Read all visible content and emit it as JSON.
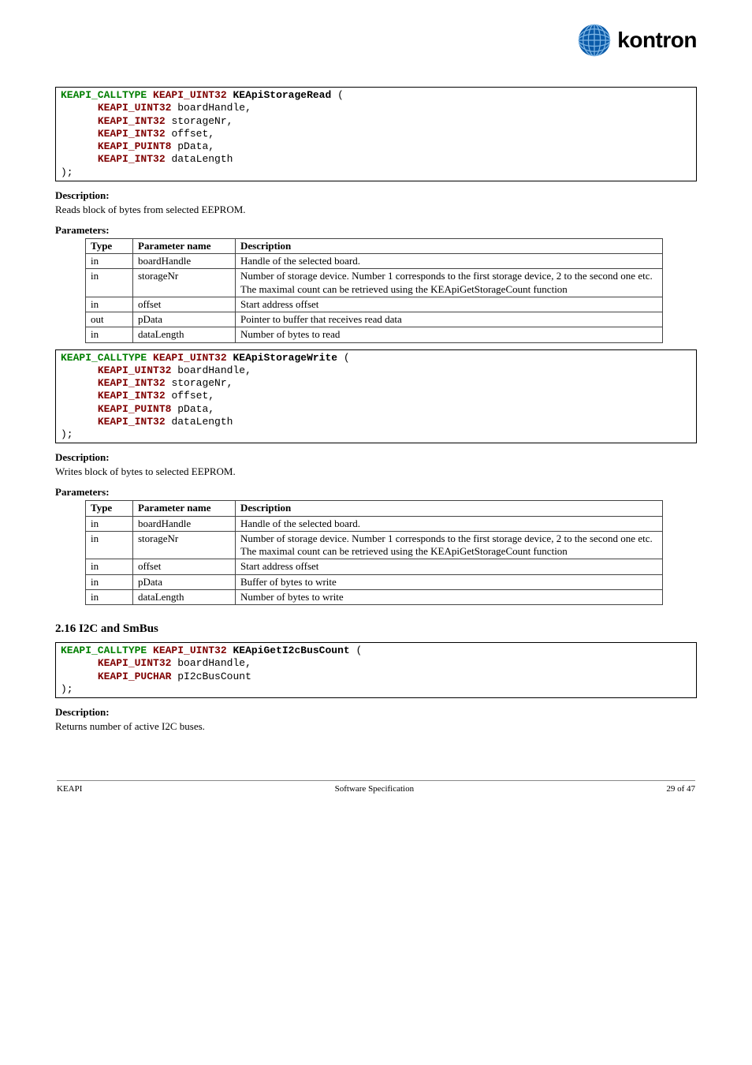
{
  "brand": {
    "name": "kontron"
  },
  "code1": {
    "prefix": "KEAPI_CALLTYPE KEAPI_UINT32",
    "fn": "KEApiStorageRead",
    "p1_type": "KEAPI_UINT32",
    "p1_name": "boardHandle",
    "p2_type": "KEAPI_INT32",
    "p2_name": "storageNr",
    "p3_type": "KEAPI_INT32",
    "p3_name": "offset",
    "p4_type": "KEAPI_PUINT8",
    "p4_name": "pData",
    "p5_type": "KEAPI_INT32",
    "p5_name": "dataLength"
  },
  "sec": {
    "desc_label": "Description:",
    "params_label": "Parameters:"
  },
  "desc1": "Reads block of bytes from selected EEPROM.",
  "table_headers": {
    "type": "Type",
    "name": "Parameter name",
    "desc": "Description"
  },
  "tbl1": [
    {
      "t": "in",
      "n": "boardHandle",
      "d": "Handle of the selected board."
    },
    {
      "t": "in",
      "n": "storageNr",
      "d": "Number of storage device. Number 1 corresponds to the first storage device, 2 to the second one etc. The maximal count can be retrieved using the KEApiGetStorageCount function"
    },
    {
      "t": "in",
      "n": "offset",
      "d": "Start address offset"
    },
    {
      "t": "out",
      "n": "pData",
      "d": "Pointer to buffer that receives read data"
    },
    {
      "t": "in",
      "n": "dataLength",
      "d": "Number of bytes to read"
    }
  ],
  "code2": {
    "prefix": "KEAPI_CALLTYPE KEAPI_UINT32",
    "fn": "KEApiStorageWrite",
    "p1_type": "KEAPI_UINT32",
    "p1_name": "boardHandle",
    "p2_type": "KEAPI_INT32",
    "p2_name": "storageNr",
    "p3_type": "KEAPI_INT32",
    "p3_name": "offset",
    "p4_type": "KEAPI_PUINT8",
    "p4_name": "pData",
    "p5_type": "KEAPI_INT32",
    "p5_name": "dataLength"
  },
  "desc2": "Writes block of bytes to selected EEPROM.",
  "tbl2": [
    {
      "t": "in",
      "n": "boardHandle",
      "d": "Handle of the selected board."
    },
    {
      "t": "in",
      "n": "storageNr",
      "d": "Number of storage device. Number 1 corresponds to the first storage device, 2 to the second one etc. The maximal count can be retrieved using the KEApiGetStorageCount function"
    },
    {
      "t": "in",
      "n": "offset",
      "d": "Start address offset"
    },
    {
      "t": "in",
      "n": "pData",
      "d": "Buffer of bytes to write"
    },
    {
      "t": "in",
      "n": "dataLength",
      "d": "Number of bytes to write"
    }
  ],
  "heading_i2c": "2.16 I2C and SmBus",
  "code3": {
    "prefix": "KEAPI_CALLTYPE KEAPI_UINT32",
    "fn": "KEApiGetI2cBusCount",
    "p1_type": "KEAPI_UINT32",
    "p1_name": "boardHandle",
    "p2_type": "KEAPI_PUCHAR",
    "p2_name": "pI2cBusCount"
  },
  "desc3": "Returns number of active I2C buses.",
  "footer": {
    "left": "KEAPI",
    "center": "Software Specification",
    "right": "29 of 47"
  }
}
